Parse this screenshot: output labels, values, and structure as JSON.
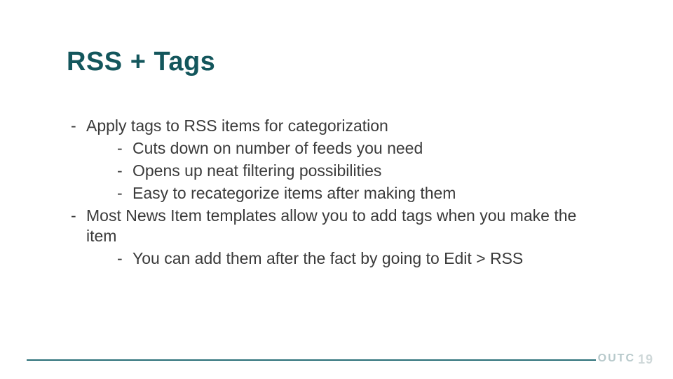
{
  "title": "RSS + Tags",
  "bullets": {
    "b1": "Apply tags to RSS items for categorization",
    "b1a": "Cuts down on number of feeds you need",
    "b1b": "Opens up neat filtering possibilities",
    "b1c": "Easy to recategorize items after making them",
    "b2": "Most News Item templates allow you to add tags when you make the item",
    "b2a": "You can add them after the fact by going to Edit > RSS"
  },
  "footer": {
    "brand": "OUTC",
    "page": "19"
  }
}
